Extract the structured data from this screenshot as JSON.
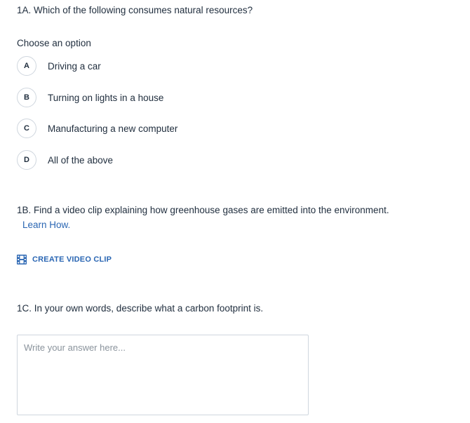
{
  "question_1a": {
    "text": "1A. Which of the following consumes natural resources?",
    "prompt": "Choose an option",
    "options": [
      {
        "letter": "A",
        "label": "Driving a car"
      },
      {
        "letter": "B",
        "label": "Turning on lights in a house"
      },
      {
        "letter": "C",
        "label": "Manufacturing a new computer"
      },
      {
        "letter": "D",
        "label": "All of the above"
      }
    ]
  },
  "question_1b": {
    "text": "1B. Find a video clip explaining how greenhouse gases are emitted into the environment.",
    "learn_how": "Learn How.",
    "create_clip_label": "CREATE VIDEO CLIP",
    "create_clip_icon": "film-icon"
  },
  "question_1c": {
    "text": "1C. In your own words, describe what a carbon footprint is.",
    "answer_placeholder": "Write your answer here...",
    "answer_value": ""
  },
  "colors": {
    "text": "#1f2d3d",
    "link": "#2a66b3",
    "border": "#cfd6de",
    "placeholder": "#8a939c"
  }
}
